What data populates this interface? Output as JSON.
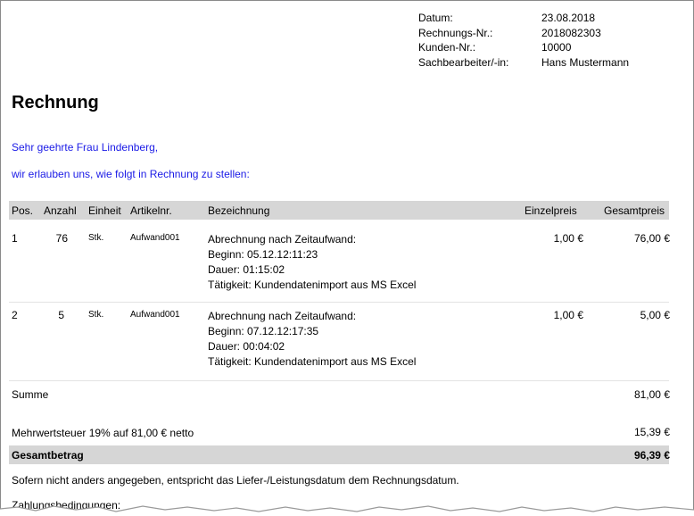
{
  "meta": {
    "rows": [
      {
        "label": "Datum:",
        "value": "23.08.2018"
      },
      {
        "label": "Rechnungs-Nr.:",
        "value": "2018082303"
      },
      {
        "label": "Kunden-Nr.:",
        "value": "10000"
      },
      {
        "label": "Sachbearbeiter/-in:",
        "value": "Hans Mustermann"
      }
    ]
  },
  "title": "Rechnung",
  "salutation": "Sehr geehrte Frau Lindenberg,",
  "intro": "wir erlauben uns, wie folgt in Rechnung zu stellen:",
  "table": {
    "headers": {
      "pos": "Pos.",
      "qty": "Anzahl",
      "unit": "Einheit",
      "article": "Artikelnr.",
      "desc": "Bezeichnung",
      "unit_price": "Einzelpreis",
      "total": "Gesamtpreis"
    },
    "rows": [
      {
        "pos": "1",
        "qty": "76",
        "unit": "Stk.",
        "article": "Aufwand001",
        "desc": [
          "Abrechnung nach Zeitaufwand:",
          "Beginn: 05.12.12:11:23",
          "Dauer: 01:15:02",
          "Tätigkeit: Kundendatenimport aus MS Excel"
        ],
        "unit_price": "1,00 €",
        "total": "76,00 €"
      },
      {
        "pos": "2",
        "qty": "5",
        "unit": "Stk.",
        "article": "Aufwand001",
        "desc": [
          "Abrechnung nach Zeitaufwand:",
          "Beginn: 07.12.12:17:35",
          "Dauer: 00:04:02",
          "Tätigkeit: Kundendatenimport aus MS Excel"
        ],
        "unit_price": "1,00 €",
        "total": "5,00 €"
      }
    ]
  },
  "summary": {
    "sum_label": "Summe",
    "sum_value": "81,00 €",
    "vat_label": "Mehrwertsteuer 19% auf 81,00 € netto",
    "vat_value": "15,39 €",
    "grand_label": "Gesamtbetrag",
    "grand_value": "96,39 €"
  },
  "footer": {
    "note": "Sofern nicht anders angegeben, entspricht das Liefer-/Leistungsdatum dem Rechnungsdatum.",
    "payment_terms": "Zahlungsbedingungen:"
  },
  "colors": {
    "accent_text": "#1a1ae6",
    "header_bar": "#d6d6d6"
  }
}
